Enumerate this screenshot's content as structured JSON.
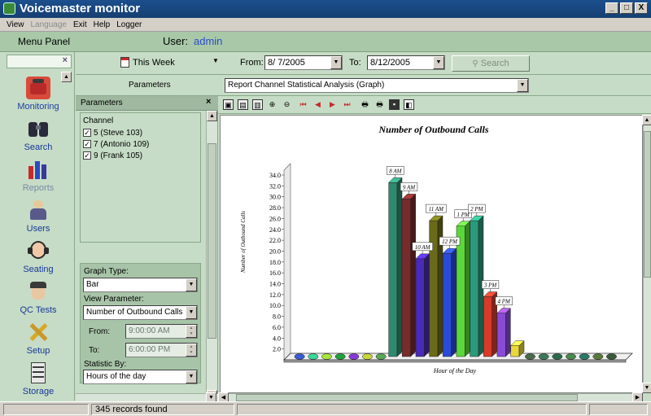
{
  "window": {
    "title": "Voicemaster monitor",
    "min": "_",
    "max": "□",
    "close": "X"
  },
  "menu": [
    "View",
    "Language",
    "Exit",
    "Help",
    "Logger"
  ],
  "header": {
    "menu_panel": "Menu Panel",
    "user_label": "User:",
    "user_value": "admin"
  },
  "nav": {
    "close": "×",
    "items": [
      {
        "label": "Monitoring",
        "icon": "phone-icon"
      },
      {
        "label": "Search",
        "icon": "binoculars-icon"
      },
      {
        "label": "Reports",
        "icon": "reports-icon"
      },
      {
        "label": "Users",
        "icon": "users-icon"
      },
      {
        "label": "Seating",
        "icon": "headset-icon"
      },
      {
        "label": "QC Tests",
        "icon": "officer-icon"
      },
      {
        "label": "Setup",
        "icon": "tools-icon"
      },
      {
        "label": "Storage",
        "icon": "storage-icon"
      }
    ]
  },
  "daterow": {
    "period": "This Week",
    "from_label": "From:",
    "from_value": "8/ 7/2005",
    "to_label": "To:",
    "to_value": "8/12/2005",
    "search_label": "Search"
  },
  "paramrow": {
    "label": "Parameters",
    "report": "Report Channel Statistical Analysis (Graph)"
  },
  "params_panel": {
    "title": "Parameters",
    "close": "×",
    "channel_label": "Channel",
    "channels": [
      "5 (Steve 103)",
      "7 (Antonio 109)",
      "9 (Frank 105)"
    ],
    "graph_type_label": "Graph Type:",
    "graph_type": "Bar",
    "view_param_label": "View Parameter:",
    "view_param": "Number of Outbound Calls",
    "from_label": "From:",
    "from_time": "9:00:00 AM",
    "to_label": "To:",
    "to_time": "6:00:00 PM",
    "statistic_label": "Statistic By:",
    "statistic": "Hours of the day"
  },
  "status": {
    "records": "345 records found"
  },
  "colors": {
    "panel": "#c6dcc6",
    "header": "#a8c8a8",
    "accent": "#1c4f8e"
  },
  "chart_data": {
    "type": "bar",
    "title": "Number of Outbound Calls",
    "xlabel": "Hour of the Day",
    "ylabel": "Number of Outbound Calls",
    "ylim": [
      0,
      34
    ],
    "yticks": [
      "2.0",
      "4.0",
      "6.0",
      "8.0",
      "10.0",
      "12.0",
      "14.0",
      "16.0",
      "18.0",
      "20.0",
      "22.0",
      "24.0",
      "26.0",
      "28.0",
      "30.0",
      "32.0",
      "34.0"
    ],
    "categories": [
      "",
      "",
      "",
      "",
      "",
      "",
      "",
      "8 AM",
      "9 AM",
      "10 AM",
      "11 AM",
      "12 PM",
      "1 PM",
      "2 PM",
      "3 PM",
      "4 PM",
      "",
      "",
      "",
      "",
      "",
      "",
      "",
      ""
    ],
    "values": [
      0,
      0,
      0,
      0,
      0,
      0,
      0,
      32,
      29,
      18,
      25,
      19,
      24,
      25,
      11,
      8,
      2,
      0,
      0,
      0,
      0,
      0,
      0,
      0
    ],
    "colors": [
      "#3a5bd8",
      "#3ad89a",
      "#a6e83a",
      "#1fa33a",
      "#8a3ad8",
      "#c8d83a",
      "#5aa85a",
      "#2e8a6e",
      "#7a2a2a",
      "#4a2ab8",
      "#6a6a1a",
      "#2a4ad8",
      "#5ad83a",
      "#2a9a7a",
      "#d83a2a",
      "#8a4ad8",
      "#e8d83a",
      "#4a6a4a",
      "#3a7a5a",
      "#2a6a4a",
      "#4a8a4a",
      "#2a7a6a",
      "#5a7a3a",
      "#3a5a3a"
    ]
  }
}
